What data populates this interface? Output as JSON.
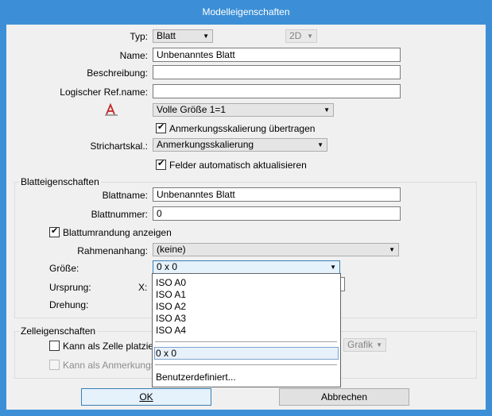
{
  "window": {
    "title": "Modelleigenschaften"
  },
  "typ": {
    "label": "Typ:",
    "value": "Blatt",
    "dim_value": "2D"
  },
  "name": {
    "label": "Name:",
    "value": "Unbenanntes Blatt"
  },
  "beschreibung": {
    "label": "Beschreibung:",
    "value": ""
  },
  "ref": {
    "label": "Logischer Ref.name:",
    "value": ""
  },
  "annotation_scale": {
    "value": "Volle Größe 1=1"
  },
  "cb_anmerkung": {
    "label": "Anmerkungsskalierung übertragen",
    "checked": true
  },
  "strichart": {
    "label": "Strichartskal.:",
    "value": "Anmerkungsskalierung"
  },
  "cb_felder": {
    "label": "Felder automatisch aktualisieren",
    "checked": true
  },
  "blatt_group": {
    "title": "Blatteigenschaften",
    "blattname_label": "Blattname:",
    "blattname_value": "Unbenanntes Blatt",
    "blattnummer_label": "Blattnummer:",
    "blattnummer_value": "0",
    "umrandung_label": "Blattumrandung anzeigen",
    "rahmen_label": "Rahmenanhang:",
    "rahmen_value": "(keine)",
    "groesse_label": "Größe:",
    "groesse_value": "0 x 0",
    "ursprung_label": "Ursprung:",
    "x_label": "X:",
    "drehung_label": "Drehung:"
  },
  "size_dropdown": {
    "items": [
      "ISO A0",
      "ISO A1",
      "ISO A2",
      "ISO A3",
      "ISO A4"
    ],
    "current": "0 x 0",
    "custom": "Benutzerdefiniert..."
  },
  "zelle_group": {
    "title": "Zelleigenschaften",
    "cb1_label": "Kann als Zelle platziert w",
    "cb2_label": "Kann als Anmerkungsze",
    "grafik_value": "Grafik"
  },
  "buttons": {
    "ok": "OK",
    "cancel": "Abbrechen"
  }
}
